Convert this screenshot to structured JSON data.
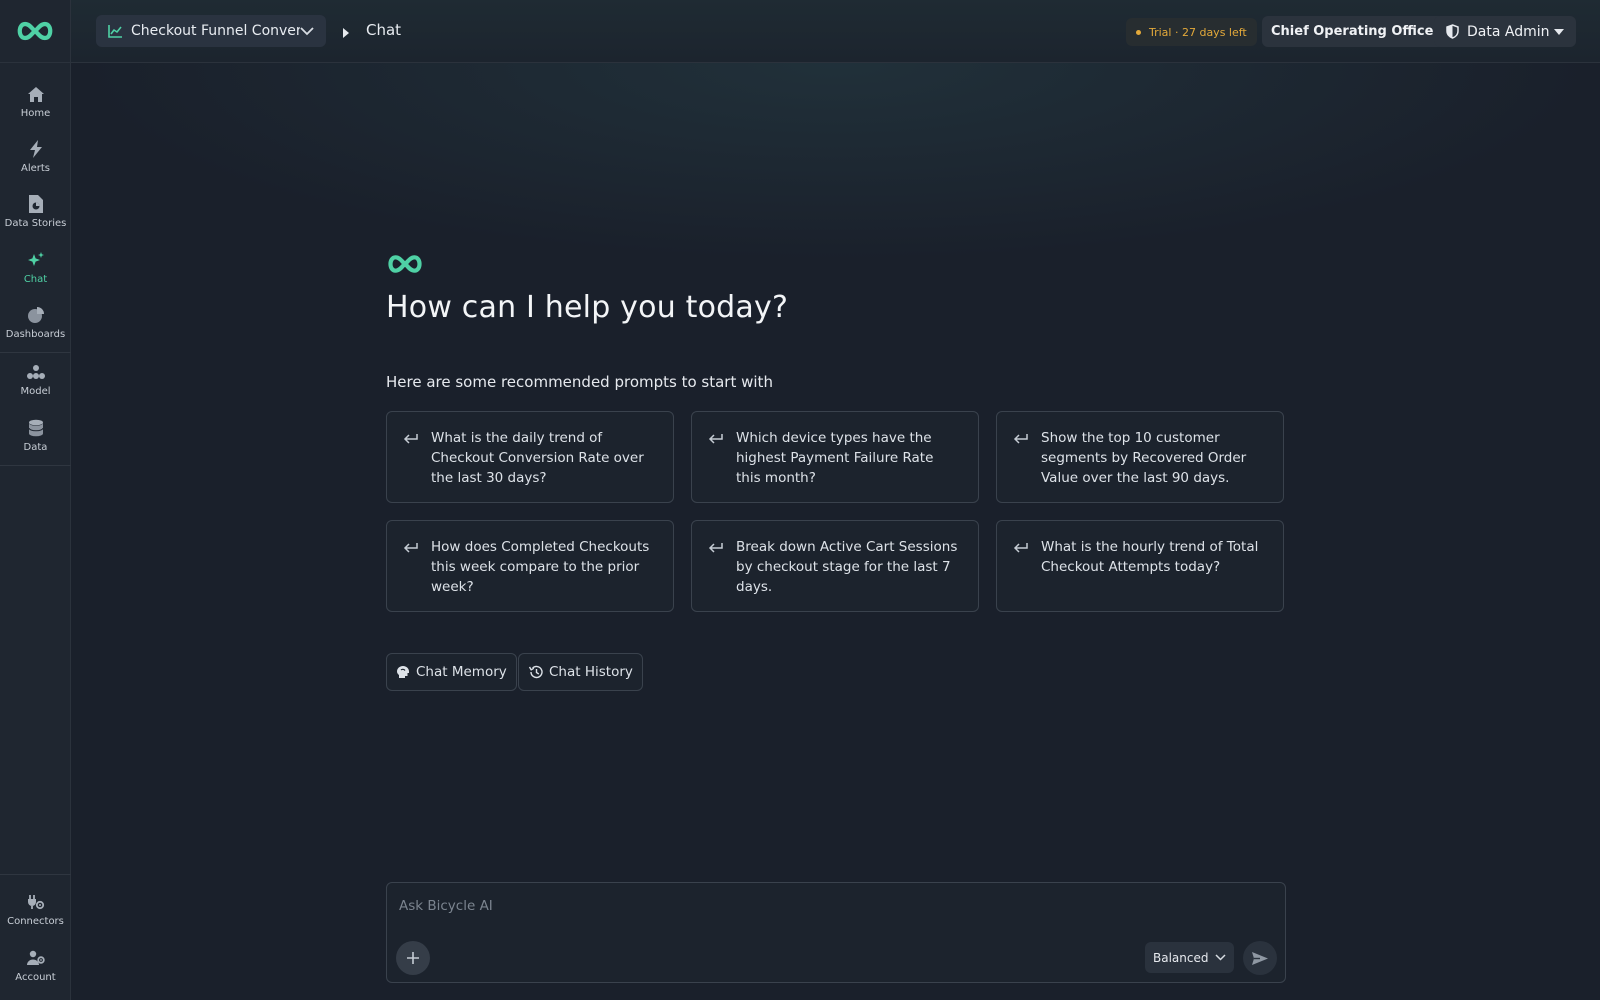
{
  "sidebar": {
    "items": [
      {
        "label": "Home",
        "icon": "home-icon"
      },
      {
        "label": "Alerts",
        "icon": "bolt-icon"
      },
      {
        "label": "Data Stories",
        "icon": "document-chart-icon"
      },
      {
        "label": "Chat",
        "icon": "sparkles-icon"
      },
      {
        "label": "Dashboards",
        "icon": "pie-chart-icon"
      },
      {
        "label": "Model",
        "icon": "model-graph-icon"
      },
      {
        "label": "Data",
        "icon": "database-icon"
      }
    ],
    "bottom_items": [
      {
        "label": "Connectors",
        "icon": "plug-icon"
      },
      {
        "label": "Account",
        "icon": "user-gear-icon"
      }
    ],
    "active": "Chat"
  },
  "header": {
    "dataset_label": "Checkout Funnel Conver...",
    "breadcrumb": "Chat",
    "trial_text": "Trial · 27 days left",
    "role_label": "Chief Operating Officer",
    "admin_label": "Data Admin"
  },
  "main": {
    "title": "How can I help you today?",
    "recommended_heading": "Here are some recommended prompts to start with",
    "prompts": [
      "What is the daily trend of Checkout Conversion Rate over the last 30 days?",
      "Which device types have the highest Payment Failure Rate this month?",
      "Show the top 10 customer segments by Recovered Order Value over the last 90 days.",
      "How does Completed Checkouts this week compare to the prior week?",
      "Break down Active Cart Sessions by checkout stage for the last 7 days.",
      "What is the hourly trend of Total Checkout Attempts today?"
    ],
    "memory_label": "Chat Memory",
    "history_label": "Chat History"
  },
  "composer": {
    "placeholder": "Ask Bicycle AI",
    "value": "",
    "mode": "Balanced"
  },
  "colors": {
    "accent": "#4fd1a5",
    "background": "#1a202b",
    "sidebar": "#1f2630",
    "trial": "#e3a93a"
  }
}
